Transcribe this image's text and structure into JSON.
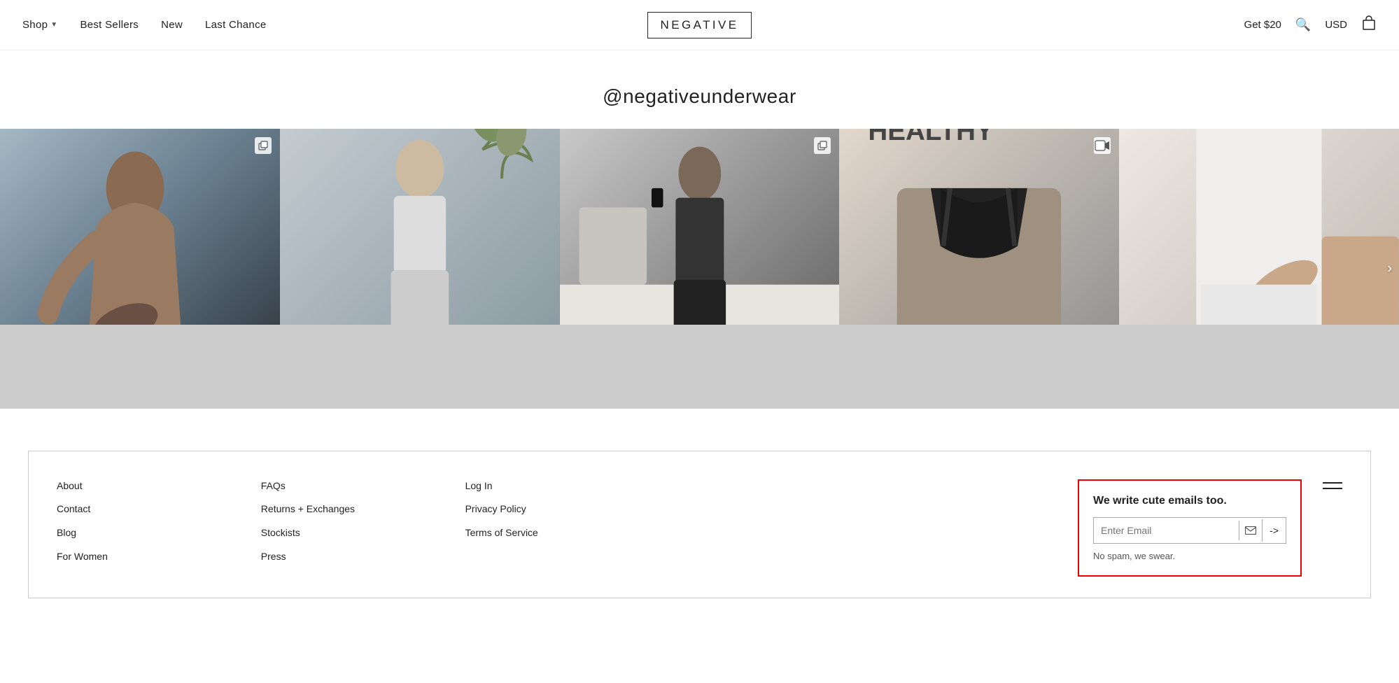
{
  "header": {
    "logo": "NEGATIVE",
    "nav_left": [
      {
        "label": "Shop",
        "has_chevron": true
      },
      {
        "label": "Best Sellers"
      },
      {
        "label": "New"
      },
      {
        "label": "Last Chance"
      }
    ],
    "nav_right": {
      "get_credit": "Get $20",
      "currency": "USD"
    }
  },
  "instagram": {
    "handle": "@negativeunderwear"
  },
  "photos": [
    {
      "id": 1,
      "badge": "multi",
      "alt": "Woman in lingerie sitting"
    },
    {
      "id": 2,
      "badge": null,
      "alt": "Woman in white outfit"
    },
    {
      "id": 3,
      "badge": "multi",
      "alt": "Person in dark outfit"
    },
    {
      "id": 4,
      "badge": "video",
      "alt": "Woman in dark bra with HEALTHY sign"
    },
    {
      "id": 5,
      "badge": null,
      "alt": "Woman in white"
    }
  ],
  "footer": {
    "col1": {
      "links": [
        {
          "label": "About"
        },
        {
          "label": "Contact"
        },
        {
          "label": "Blog"
        },
        {
          "label": "For Women"
        }
      ]
    },
    "col2": {
      "links": [
        {
          "label": "FAQs"
        },
        {
          "label": "Returns + Exchanges"
        },
        {
          "label": "Stockists"
        },
        {
          "label": "Press"
        }
      ]
    },
    "col3": {
      "links": [
        {
          "label": "Log In"
        },
        {
          "label": "Privacy Policy"
        },
        {
          "label": "Terms of Service"
        }
      ]
    },
    "email_signup": {
      "title": "We write cute emails too.",
      "placeholder": "Enter Email",
      "submit_label": "->",
      "no_spam": "No spam, we swear."
    }
  }
}
